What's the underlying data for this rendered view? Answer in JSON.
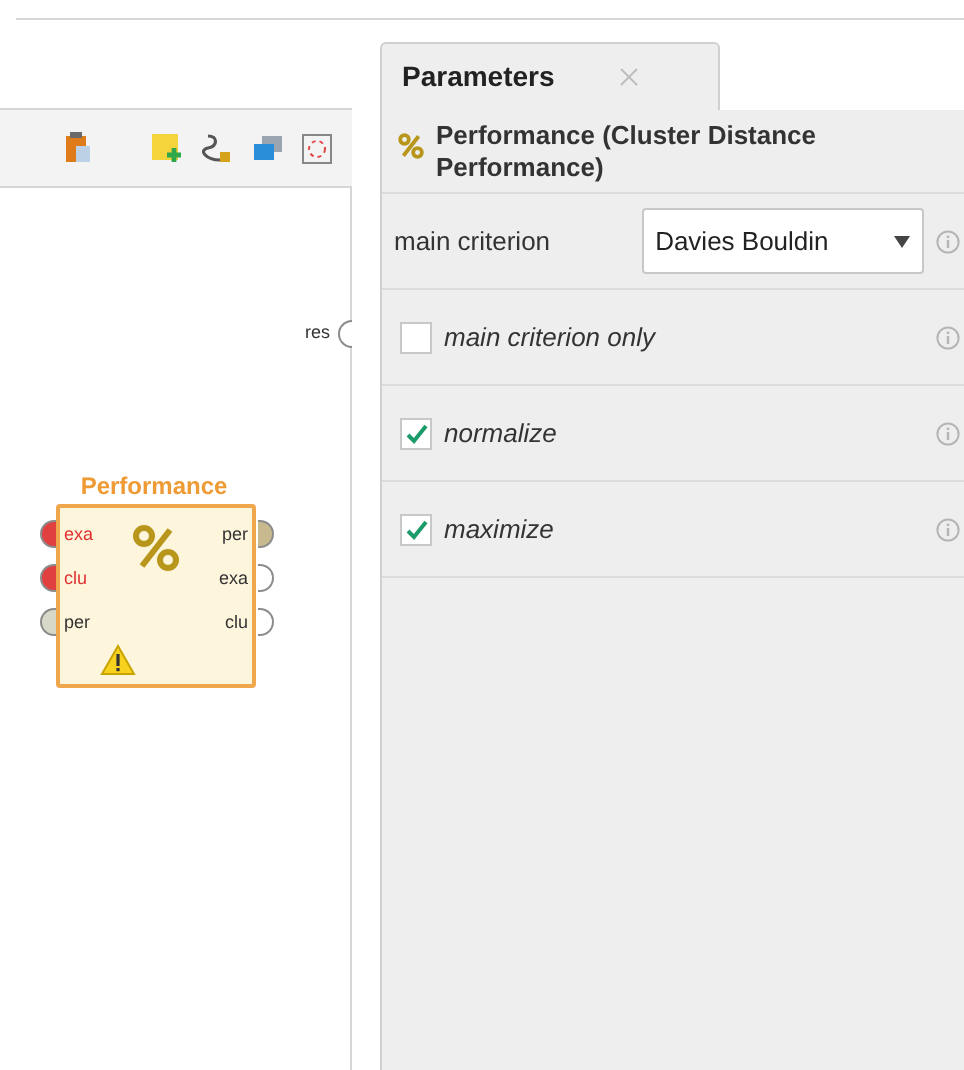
{
  "canvas": {
    "output_port": "res",
    "operator": {
      "title": "Performance",
      "warning": true,
      "inputs": [
        {
          "label": "exa",
          "required": true
        },
        {
          "label": "clu",
          "required": true
        },
        {
          "label": "per",
          "required": false
        }
      ],
      "outputs": [
        {
          "label": "per",
          "connected": true
        },
        {
          "label": "exa",
          "connected": false
        },
        {
          "label": "clu",
          "connected": false
        }
      ]
    }
  },
  "panel": {
    "tabs": [
      {
        "label": "Parameters",
        "selected": true
      }
    ],
    "operator_title": "Performance (Cluster Distance Performance)",
    "params": [
      {
        "kind": "select",
        "label": "main criterion",
        "value": "Davies Bouldin"
      },
      {
        "kind": "checkbox",
        "label": "main criterion only",
        "checked": false
      },
      {
        "kind": "checkbox",
        "label": "normalize",
        "checked": true
      },
      {
        "kind": "checkbox",
        "label": "maximize",
        "checked": true
      }
    ]
  }
}
